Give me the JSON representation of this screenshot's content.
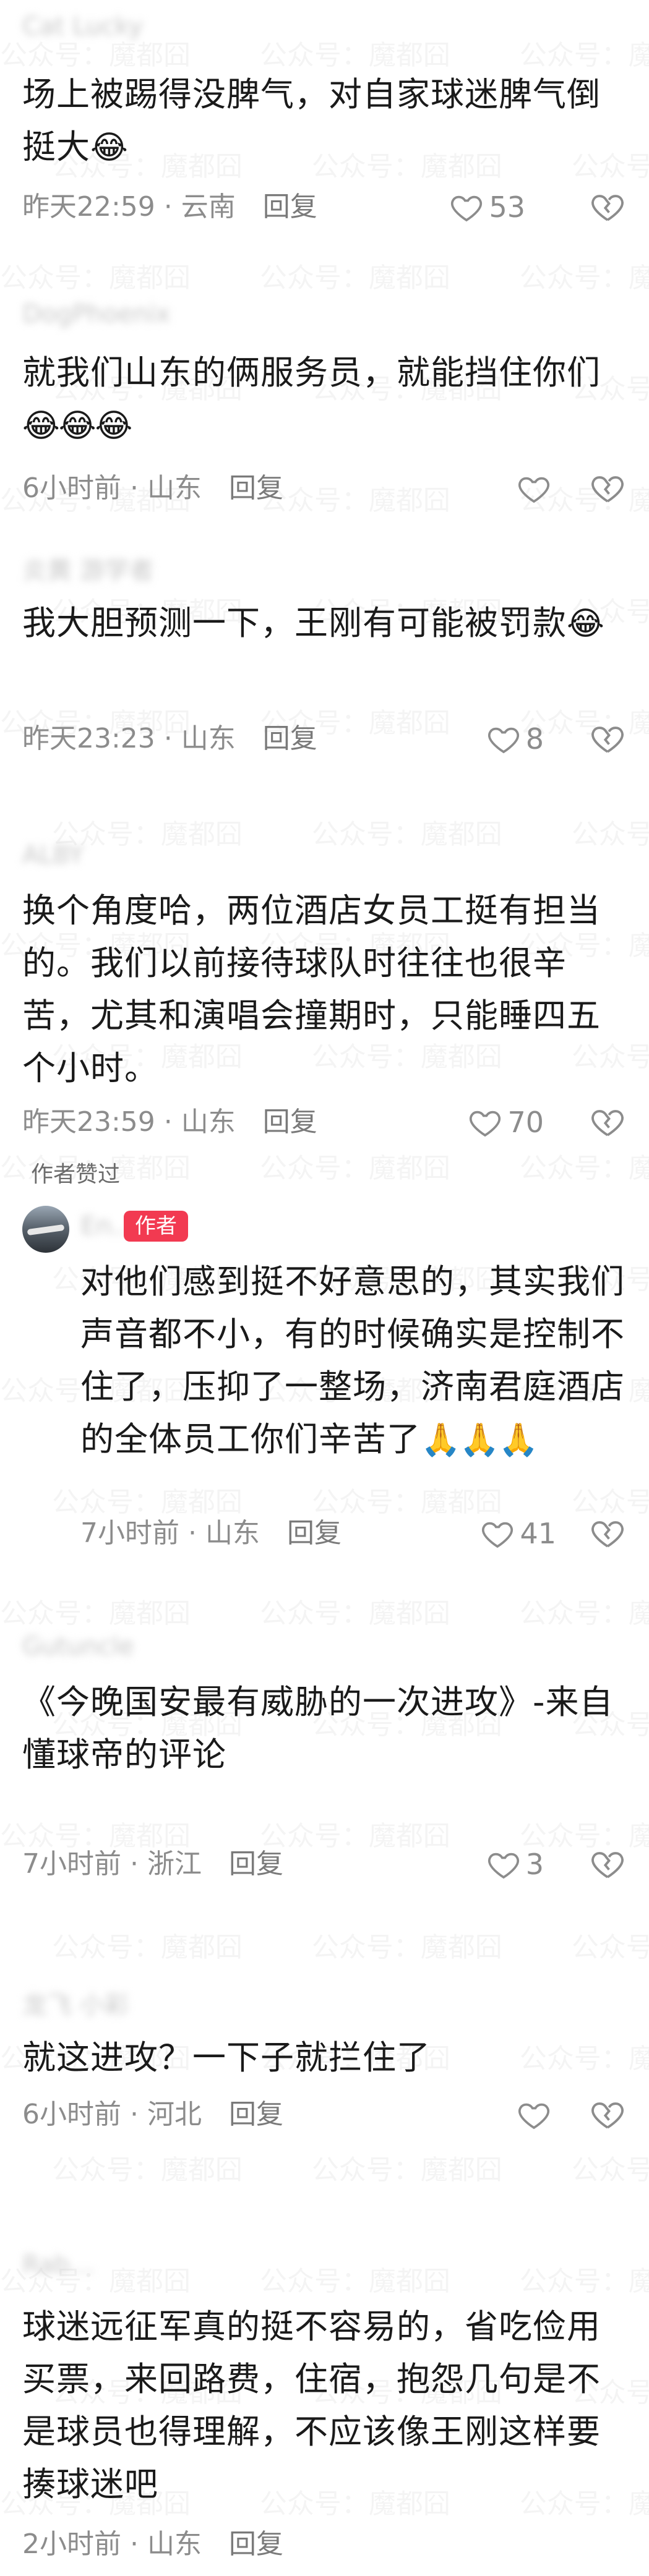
{
  "watermark": "公众号：魔都囧",
  "author_liked_label": "作者赞过",
  "author_badge": "作者",
  "colors": {
    "author_badge": "#f23a51",
    "meta": "#8c8c8c"
  },
  "comments": [
    {
      "text": "场上被踢得没脾气，对自家球迷脾气倒挺大",
      "emoji": "😂",
      "time": "昨天22:59 · 云南",
      "reply": "回复",
      "likes": "53"
    },
    {
      "text": "就我们山东的俩服务员，就能挡住你们",
      "emoji": "😂😂😂",
      "time": "6小时前 · 山东",
      "reply": "回复",
      "likes": ""
    },
    {
      "text": "我大胆预测一下，王刚有可能被罚款",
      "emoji": "😂",
      "time": "昨天23:23 · 山东",
      "reply": "回复",
      "likes": "8"
    },
    {
      "text": "换个角度哈，两位酒店女员工挺有担当的。我们以前接待球队时往往也很辛苦，尤其和演唱会撞期时，只能睡四五个小时。",
      "emoji": "",
      "time": "昨天23:59 · 山东",
      "reply": "回复",
      "likes": "70"
    },
    {
      "text": "对他们感到挺不好意思的，其实我们声音都不小，有的时候确实是控制不住了，压抑了一整场，济南君庭酒店的全体员工你们辛苦了",
      "emoji": "🙏🙏🙏",
      "time": "7小时前 · 山东",
      "reply": "回复",
      "likes": "41"
    },
    {
      "text": "《今晚国安最有威胁的一次进攻》-来自懂球帝的评论",
      "emoji": "",
      "time": "7小时前 · 浙江",
      "reply": "回复",
      "likes": "3"
    },
    {
      "text": "就这进攻？一下子就拦住了",
      "emoji": "",
      "time": "6小时前 · 河北",
      "reply": "回复",
      "likes": ""
    },
    {
      "text": "球迷远征军真的挺不容易的，省吃俭用买票，来回路费，住宿，抱怨几句是不是球员也得理解，不应该像王刚这样要揍球迷吧",
      "emoji": "",
      "time": "2小时前 · 山东",
      "reply": "回复",
      "likes": ""
    }
  ]
}
